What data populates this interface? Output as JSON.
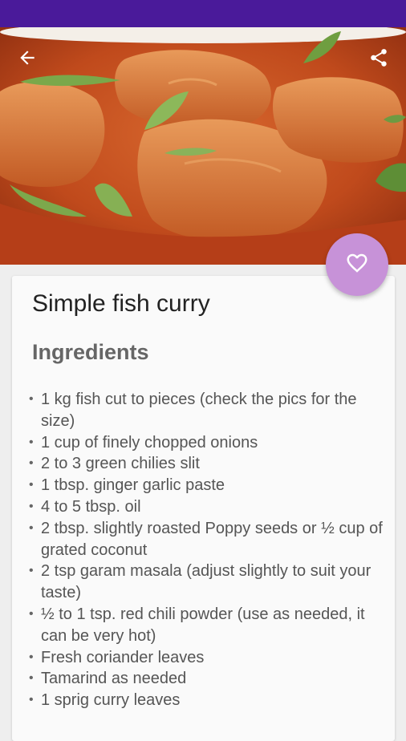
{
  "app": {
    "status_bar_color": "#4a1a9a",
    "accent_color": "#c792d8"
  },
  "header": {
    "image_alt": "fish curry photo",
    "back_icon": "arrow-back-icon",
    "share_icon": "share-icon"
  },
  "favorite": {
    "icon": "heart-outline-icon",
    "color": "#c792d8"
  },
  "recipe": {
    "title": "Simple fish curry",
    "ingredients_heading": "Ingredients",
    "ingredients": [
      "1 kg fish cut to pieces (check the pics for the size)",
      "1 cup of finely chopped onions",
      "2 to 3 green chilies slit",
      "1 tbsp. ginger garlic paste",
      "4 to 5 tbsp. oil",
      "2 tbsp. slightly roasted Poppy seeds or ½ cup of grated coconut",
      "2 tsp garam masala (adjust slightly to suit your taste)",
      "½ to 1 tsp. red chili powder (use as needed, it can be very hot)",
      "Fresh coriander leaves",
      "Tamarind as needed",
      "1 sprig curry leaves"
    ]
  }
}
